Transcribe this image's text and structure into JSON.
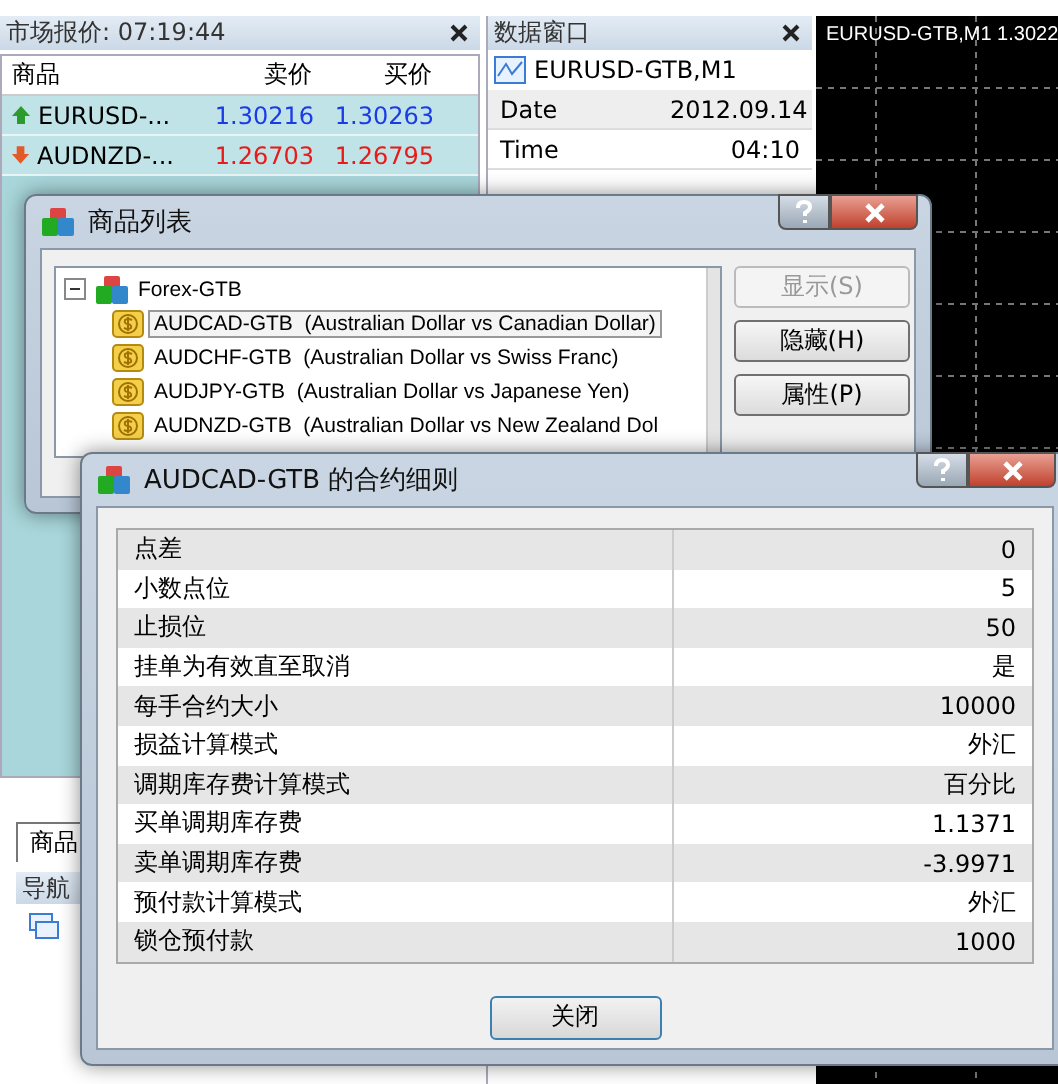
{
  "market_watch": {
    "title": "市场报价: 07:19:44",
    "columns": [
      "商品",
      "卖价",
      "买价"
    ],
    "rows": [
      {
        "symbol": "EURUSD-...",
        "bid": "1.30216",
        "ask": "1.30263",
        "kind": "up"
      },
      {
        "symbol": "AUDNZD-...",
        "bid": "1.26703",
        "ask": "1.26795",
        "kind": "down"
      }
    ],
    "tabs": [
      {
        "label": "商品",
        "selected": true
      }
    ]
  },
  "data_window": {
    "title": "数据窗口",
    "symbol": "EURUSD-GTB,M1",
    "rows": [
      {
        "label": "Date",
        "value": "2012.09.14"
      },
      {
        "label": "Time",
        "value": "04:10"
      }
    ]
  },
  "chart": {
    "label": "EURUSD-GTB,M1 1.3022"
  },
  "navigator": {
    "title": "导航"
  },
  "symbols_dialog": {
    "title": "商品列表",
    "tree": [
      {
        "label": "Forex-GTB",
        "expanded": true,
        "children": [
          {
            "label": "AUDCAD-GTB  (Australian Dollar vs Canadian Dollar)",
            "selected": true
          },
          {
            "label": "AUDCHF-GTB  (Australian Dollar vs Swiss Franc)",
            "selected": false
          },
          {
            "label": "AUDJPY-GTB  (Australian Dollar vs Japanese Yen)",
            "selected": false
          },
          {
            "label": "AUDNZD-GTB  (Australian Dollar vs New Zealand Dol",
            "selected": false
          }
        ]
      }
    ],
    "buttons": [
      {
        "label": "显示(S)",
        "disabled": true
      },
      {
        "label": "隐藏(H)",
        "disabled": false
      },
      {
        "label": "属性(P)",
        "disabled": false
      }
    ]
  },
  "spec_dialog": {
    "title": "AUDCAD-GTB 的合约细则",
    "rows": [
      {
        "label": "点差",
        "value": "0"
      },
      {
        "label": "小数点位",
        "value": "5"
      },
      {
        "label": "止损位",
        "value": "50"
      },
      {
        "label": "挂单为有效直至取消",
        "value": "是"
      },
      {
        "label": "每手合约大小",
        "value": "10000"
      },
      {
        "label": "损益计算模式",
        "value": "外汇"
      },
      {
        "label": "调期库存费计算模式",
        "value": "百分比"
      },
      {
        "label": "买单调期库存费",
        "value": "1.1371"
      },
      {
        "label": "卖单调期库存费",
        "value": "-3.9971"
      },
      {
        "label": "预付款计算模式",
        "value": "外汇"
      },
      {
        "label": "锁仓预付款",
        "value": "1000"
      }
    ],
    "close_button": "关闭"
  }
}
